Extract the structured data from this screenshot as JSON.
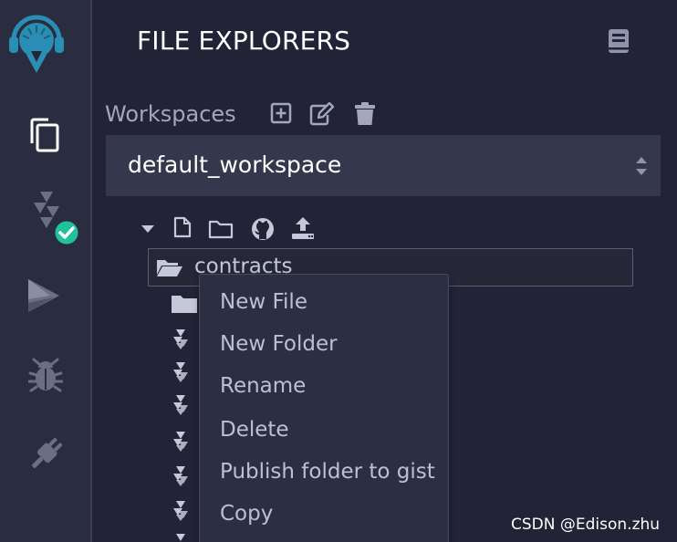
{
  "sidebar": {
    "logo_icon": "remix-logo-icon",
    "items": [
      {
        "name": "file-explorer",
        "icon": "files-icon"
      },
      {
        "name": "solidity-compiler",
        "icon": "solidity-icon",
        "badge_icon": "check-icon"
      },
      {
        "name": "deploy-run",
        "icon": "ethereum-icon"
      },
      {
        "name": "debugger",
        "icon": "bug-icon"
      },
      {
        "name": "plugin-manager",
        "icon": "plug-icon"
      }
    ]
  },
  "panel": {
    "title": "FILE EXPLORERS",
    "docs_icon": "book-icon"
  },
  "workspaces": {
    "label": "Workspaces",
    "tools": [
      "add-square-icon",
      "edit-icon",
      "trash-icon"
    ],
    "selected": "default_workspace"
  },
  "tree": {
    "toolbar": [
      "caret-down-icon",
      "new-file-icon",
      "new-folder-icon",
      "github-icon",
      "upload-icon"
    ],
    "root_label": "contracts"
  },
  "context_menu": {
    "items": [
      "New File",
      "New Folder",
      "Rename",
      "Delete",
      "Publish folder to gist",
      "Copy"
    ]
  },
  "watermark": "CSDN @Edison.zhu",
  "colors": {
    "background": "#222336",
    "rail": "#2a2c3f",
    "accent": "#2a8db4",
    "success": "#1fc29a",
    "select": "#35384c"
  }
}
